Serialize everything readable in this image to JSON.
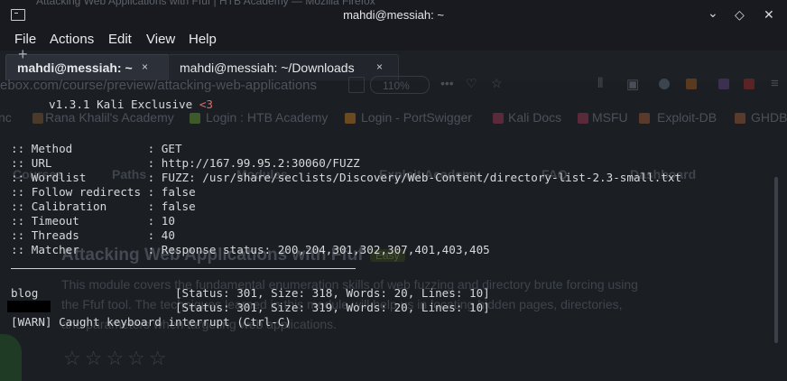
{
  "window": {
    "title": "mahdi@messiah: ~",
    "background_title": "Attacking Web Applications with Ffuf | HTB Academy — Mozilla Firefox"
  },
  "menu": [
    "File",
    "Actions",
    "Edit",
    "View",
    "Help"
  ],
  "tabs": [
    {
      "label": "mahdi@messiah: ~",
      "close": "×",
      "active": true
    },
    {
      "label": "mahdi@messiah: ~/Downloads",
      "close": "×",
      "active": false
    }
  ],
  "browser_ghost": {
    "url": "ebox.com/course/preview/attacking-web-applications",
    "zoom": "110%",
    "bookmarks": [
      "nc",
      "Rana Khalil's Academy",
      "Login : HTB Academy",
      "Login - PortSwigger",
      "Kali Docs",
      "MSFU",
      "Exploit-DB",
      "GHDB"
    ],
    "nav": [
      "Courses",
      "Paths",
      "Modules",
      "Exploit Academy",
      "FAQ",
      "Dashboard"
    ],
    "heading": "Attacking Web Applications with Ffuf",
    "badge": "Easy",
    "paragraph": [
      "This module covers the fundamental enumeration skills of web fuzzing and directory brute forcing using",
      "the Ffuf tool. The techniques learned in this module will help us in locating hidden pages, directories,",
      "and parameters when targeting web applications."
    ],
    "stars": "☆☆☆☆☆"
  },
  "terminal": {
    "version_prefix": "v1.3.1 Kali Exclusive ",
    "version_heart": "<3",
    "config": [
      ":: Method           : GET",
      ":: URL              : http://167.99.95.2:30060/FUZZ",
      ":: Wordlist         : FUZZ: /usr/share/seclists/Discovery/Web-Content/directory-list-2.3-small.txt",
      ":: Follow redirects : false",
      ":: Calibration      : false",
      ":: Timeout          : 10",
      ":: Threads          : 40",
      ":: Matcher          : Response status: 200,204,301,302,307,401,403,405"
    ],
    "results": [
      "blog                    [Status: 301, Size: 318, Words: 20, Lines: 10]",
      "                        [Status: 301, Size: 319, Words: 20, Lines: 10]"
    ],
    "warn": "[WARN] Caught keyboard interrupt (Ctrl-C)"
  },
  "colors": {
    "accent_red": "#e06c6c",
    "terminal_bg": "#1b1f24"
  }
}
